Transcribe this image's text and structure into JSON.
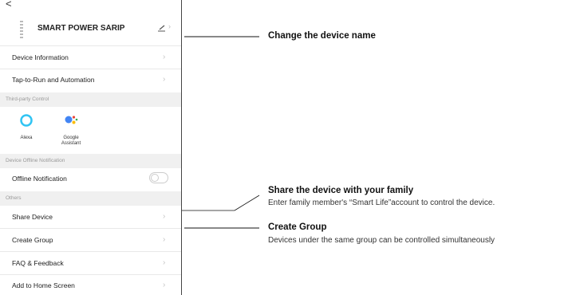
{
  "back_glyph": "<",
  "device": {
    "name": "SMART POWER SARIP"
  },
  "rows": {
    "device_information": "Device Information",
    "tap_to_run": "Tap-to-Run and Automation",
    "offline_notification": "Offline Notification",
    "share_device": "Share Device",
    "create_group": "Create Group",
    "faq_feedback": "FAQ & Feedback",
    "add_to_home": "Add to Home Screen"
  },
  "sections": {
    "third_party": "Third-party Control",
    "device_offline": "Device Offline Notification",
    "others": "Others"
  },
  "integrations": [
    {
      "label": "Alexa",
      "icon": "alexa-icon"
    },
    {
      "label": "Google",
      "label2": "Assistant",
      "icon": "google-assistant-icon"
    }
  ],
  "offline_toggle_on": false,
  "callouts": {
    "change_name": "Change the device name",
    "share_title": "Share the device with your family",
    "share_sub": "Enter family member's “Smart Life”account to control the device.",
    "group_title": "Create Group",
    "group_sub": "Devices under the same group can be controlled simultaneously"
  },
  "colors": {
    "alexa": "#31c4f3",
    "google_blue": "#4285f4",
    "google_red": "#ea4335",
    "google_yellow": "#fbbc05",
    "google_green": "#34a853"
  }
}
